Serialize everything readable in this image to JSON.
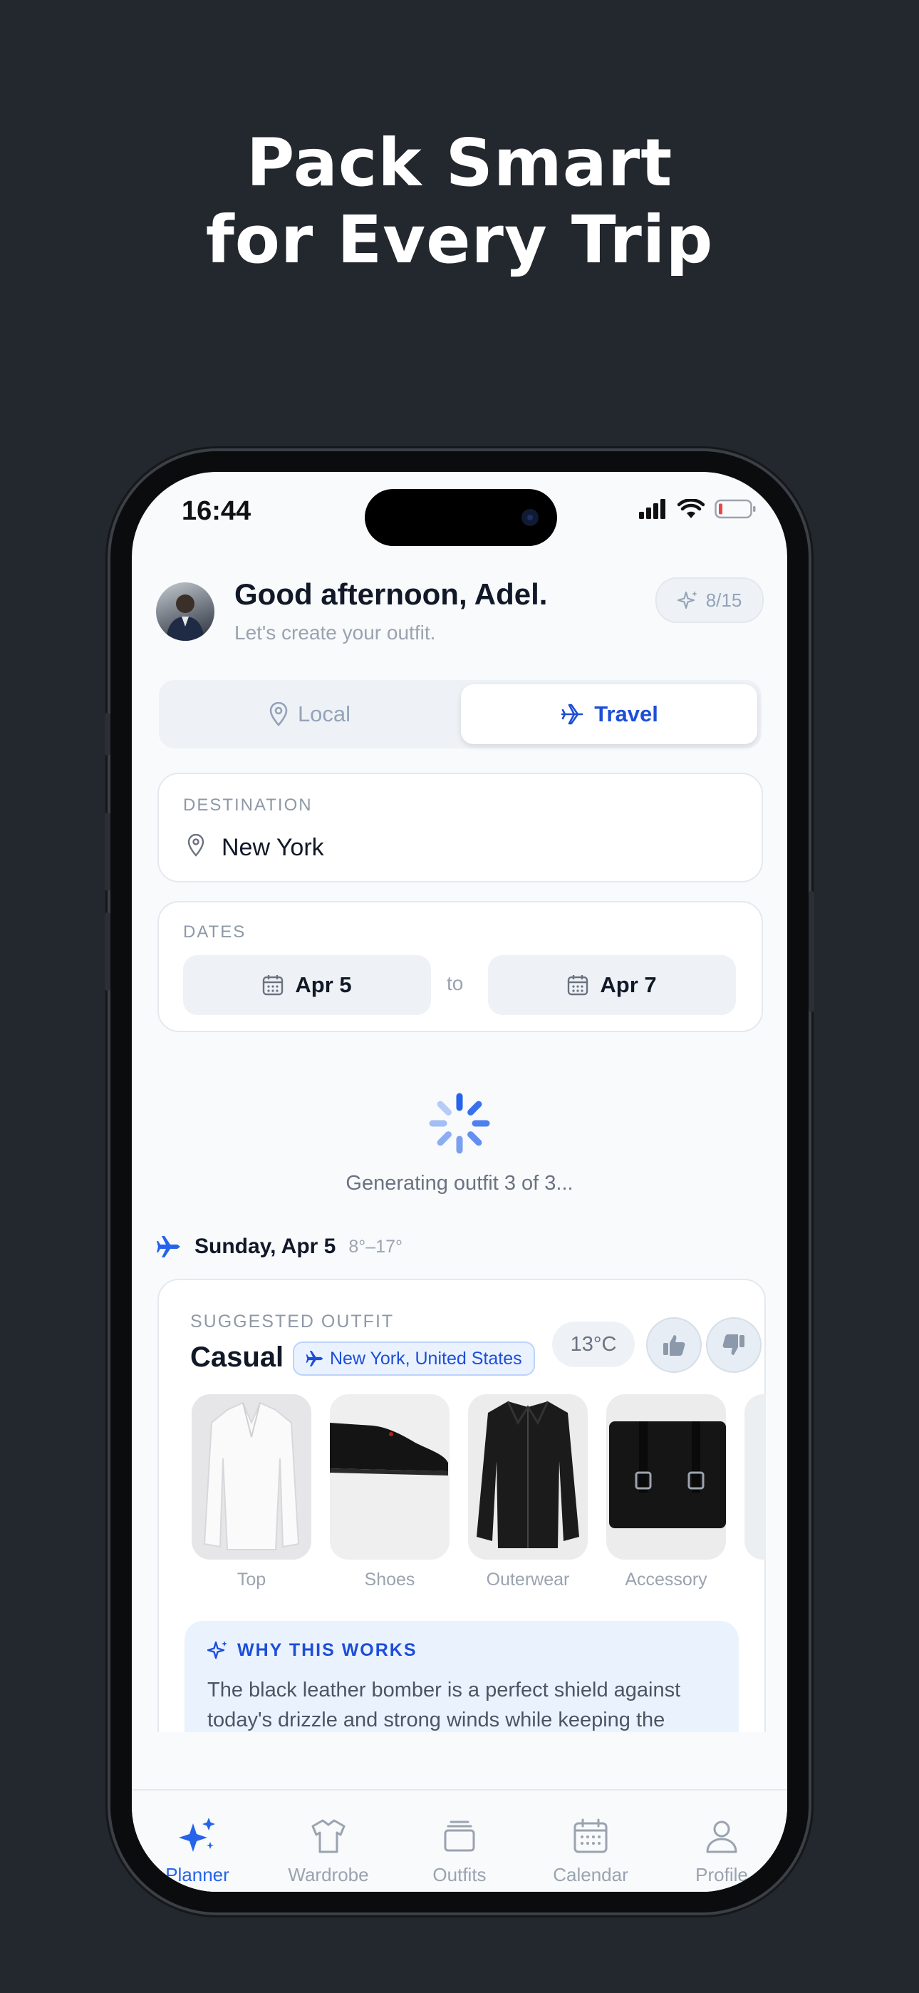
{
  "headline": {
    "line1": "Pack Smart",
    "line2": "for Every Trip"
  },
  "status_bar": {
    "time": "16:44"
  },
  "header": {
    "greeting": "Good afternoon, Adel.",
    "subtitle": "Let's create your outfit.",
    "credits": "8/15"
  },
  "mode_toggle": {
    "local": "Local",
    "travel": "Travel",
    "selected": "Travel"
  },
  "destination": {
    "label": "DESTINATION",
    "value": "New York"
  },
  "dates": {
    "label": "DATES",
    "start": "Apr 5",
    "separator": "to",
    "end": "Apr 7"
  },
  "loading": {
    "text": "Generating outfit 3 of 3..."
  },
  "day": {
    "name": "Sunday, Apr 5",
    "temp_range": "8°–17°"
  },
  "outfit": {
    "section_label": "SUGGESTED OUTFIT",
    "style": "Casual",
    "location": "New York, United States",
    "temperature": "13°C",
    "items": [
      {
        "label": "Top"
      },
      {
        "label": "Shoes"
      },
      {
        "label": "Outerwear"
      },
      {
        "label": "Accessory"
      }
    ],
    "why_title": "WHY THIS WORKS",
    "why_text": "The black leather bomber is a perfect shield against today's drizzle and strong winds while keeping the"
  },
  "tabs": [
    {
      "label": "Planner",
      "icon": "sparkles-icon"
    },
    {
      "label": "Wardrobe",
      "icon": "tshirt-icon"
    },
    {
      "label": "Outfits",
      "icon": "stack-icon"
    },
    {
      "label": "Calendar",
      "icon": "calendar-icon"
    },
    {
      "label": "Profile",
      "icon": "person-icon"
    }
  ],
  "colors": {
    "accent": "#2563eb",
    "background": "#23272e",
    "screen": "#f8fafc"
  }
}
